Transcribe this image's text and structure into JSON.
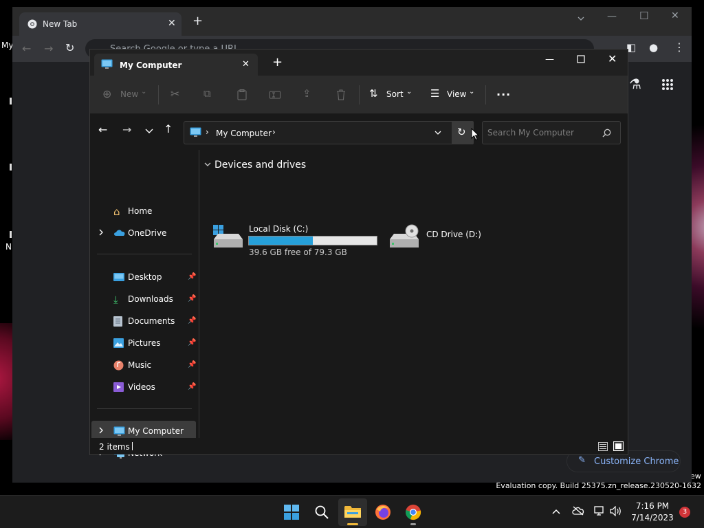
{
  "desktop": {
    "labels": [
      "My",
      "N"
    ],
    "right_edge_text": "ew"
  },
  "chrome": {
    "tab_title": "New Tab",
    "omnibox_placeholder": "Search Google or type a URL",
    "customize_label": "Customize Chrome"
  },
  "explorer": {
    "tab_title": "My Computer",
    "toolbar": {
      "new_label": "New",
      "sort_label": "Sort",
      "view_label": "View",
      "more_label": "..."
    },
    "address": {
      "path": "My Computer"
    },
    "search": {
      "placeholder": "Search My Computer"
    },
    "sidebar": {
      "items": [
        {
          "label": "Home",
          "icon": "home-icon"
        },
        {
          "label": "OneDrive",
          "icon": "onedrive-icon"
        },
        {
          "label": "Desktop",
          "icon": "desktop-icon"
        },
        {
          "label": "Downloads",
          "icon": "downloads-icon"
        },
        {
          "label": "Documents",
          "icon": "documents-icon"
        },
        {
          "label": "Pictures",
          "icon": "pictures-icon"
        },
        {
          "label": "Music",
          "icon": "music-icon"
        },
        {
          "label": "Videos",
          "icon": "videos-icon"
        },
        {
          "label": "My Computer",
          "icon": "computer-icon",
          "selected": true
        },
        {
          "label": "Network",
          "icon": "network-icon"
        }
      ]
    },
    "content": {
      "group_title": "Devices and drives",
      "drives": [
        {
          "name": "Local Disk (C:)",
          "free_text": "39.6 GB free of 79.3 GB",
          "used_fraction": 0.501,
          "icon": "hard-drive-icon"
        },
        {
          "name": "CD Drive (D:)",
          "icon": "cd-drive-icon"
        }
      ]
    },
    "status": {
      "items_count": "2 items"
    }
  },
  "system": {
    "evaluation_text": "Evaluation copy. Build 25375.zn_release.230520-1632",
    "time": "7:16 PM",
    "date": "7/14/2023",
    "notification_count": "3"
  },
  "colors": {
    "accent": "#26a0da",
    "explorer_bg": "#191919",
    "selected_bg": "#3c3c3c"
  }
}
